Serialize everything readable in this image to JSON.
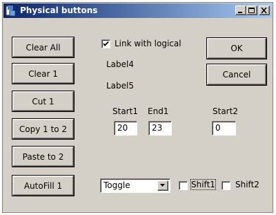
{
  "window": {
    "title": "Physical buttons",
    "icon": "app-icon",
    "controls": [
      "minimize-icon",
      "maximize-icon",
      "close-icon"
    ]
  },
  "left_buttons": [
    {
      "label": "Clear All"
    },
    {
      "label": "Clear 1"
    },
    {
      "label": "Cut 1"
    },
    {
      "label": "Copy 1 to 2"
    },
    {
      "label": "Paste to 2"
    },
    {
      "label": "AutoFill 1"
    }
  ],
  "link_checkbox": {
    "label": "Link with logical",
    "checked": true
  },
  "labels": {
    "label4": "Label4",
    "label5": "Label5"
  },
  "dialog_buttons": {
    "ok": "OK",
    "cancel": "Cancel"
  },
  "ranges": {
    "start1": {
      "label": "Start1",
      "value": "20"
    },
    "end1": {
      "label": "End1",
      "value": "23"
    },
    "start2": {
      "label": "Start2",
      "value": "0"
    }
  },
  "mode_select": {
    "selected": "Toggle"
  },
  "shift1": {
    "label": "Shift1",
    "checked": false
  },
  "shift2": {
    "label": "Shift2",
    "checked": false
  },
  "colors": {
    "title_start": "#0a246a",
    "title_end": "#a6caf0",
    "face": "#d4d0c8"
  }
}
